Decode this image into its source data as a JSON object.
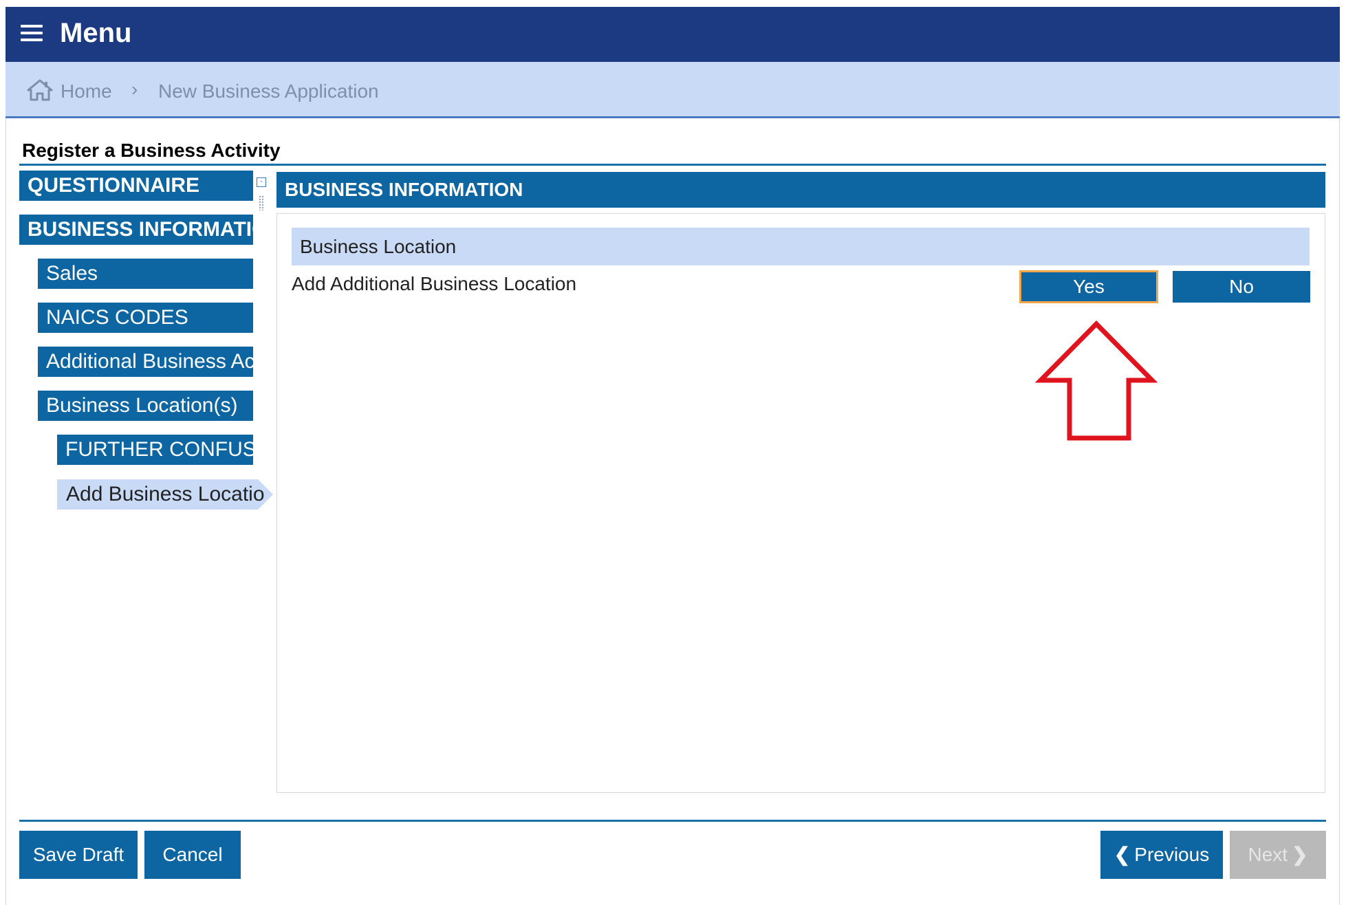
{
  "header": {
    "menu_label": "Menu"
  },
  "breadcrumb": {
    "home": "Home",
    "separator": "›",
    "current": "New Business Application"
  },
  "page": {
    "title": "Register a Business Activity"
  },
  "sidebar": {
    "items": [
      {
        "label": "QUESTIONNAIRE"
      },
      {
        "label": "BUSINESS INFORMATION"
      },
      {
        "label": "Sales"
      },
      {
        "label": "NAICS CODES"
      },
      {
        "label": "Additional Business Activities"
      },
      {
        "label": "Business Location(s)"
      },
      {
        "label": "FURTHER CONFUSION"
      },
      {
        "label": "Add Business Location"
      }
    ],
    "active_index": 7
  },
  "main": {
    "header": "BUSINESS INFORMATION",
    "section_title": "Business Location",
    "question": "Add Additional Business Location",
    "yes_label": "Yes",
    "no_label": "No"
  },
  "footer": {
    "save_draft": "Save Draft",
    "cancel": "Cancel",
    "previous": "Previous",
    "next": "Next"
  },
  "colors": {
    "topbar": "#1b3a82",
    "breadcrumb_bg": "#c8daf6",
    "primary_button": "#0d66a1",
    "selected_outline": "#f0a64a",
    "annotation_arrow": "#e0141e",
    "disabled_button": "#b9b9b9"
  }
}
